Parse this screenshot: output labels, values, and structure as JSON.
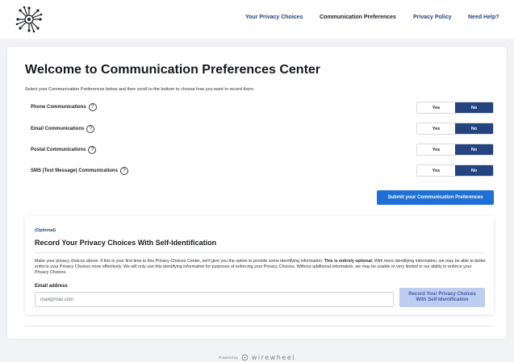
{
  "header": {
    "nav": [
      {
        "label": "Your Privacy Choices",
        "active": false
      },
      {
        "label": "Communication Preferences",
        "active": true
      },
      {
        "label": "Privacy Policy",
        "active": false
      },
      {
        "label": "Need Help?",
        "active": false
      }
    ],
    "logo_icon": "network-node-icon"
  },
  "main": {
    "title": "Welcome to Communication Preferences Center",
    "subtitle": "Select your Communication Preferences below and then scroll to the bottom to choose how you want to record them.",
    "help_glyph": "?",
    "preferences": [
      {
        "label": "Phone Communications",
        "yes_label": "Yes",
        "no_label": "No",
        "selected": "No"
      },
      {
        "label": "Email Communications",
        "yes_label": "Yes",
        "no_label": "No",
        "selected": "No"
      },
      {
        "label": "Postal Communications",
        "yes_label": "Yes",
        "no_label": "No",
        "selected": "No"
      },
      {
        "label": "SMS (Text Message) Communications",
        "yes_label": "Yes",
        "no_label": "No",
        "selected": "No"
      }
    ],
    "submit_label": "Submit your Communication Preferences"
  },
  "self_identification": {
    "optional_label": "(Optional)",
    "title": "Record Your Privacy Choices With Self-Identification",
    "body_part1": "Make your privacy choices above. If this is your first time to this Privacy Choices Center, we'll give you the option to provide some identifying information. ",
    "body_bold": "This is entirely optional.",
    "body_part2": " With more identifying information, we may be able to better enforce your Privacy Choices more effectively. We will only use this identifying information for purposes of enforcing your Privacy Choices. Without additional information, we may be unable or very limited in our ability to enforce your Privacy Choices.",
    "email_label": "Email address",
    "email_placeholder": "mail@mail.com",
    "email_value": "",
    "record_button": "Record Your Privacy Choices With Self-Identification"
  },
  "footer": {
    "powered_by": "Powered by",
    "brand": "wirewheel"
  },
  "colors": {
    "primary_navy": "#24447f",
    "submit_blue": "#1f6fd6",
    "disabled_button_bg": "#bfcdf0",
    "page_background": "#f2f3f5"
  }
}
